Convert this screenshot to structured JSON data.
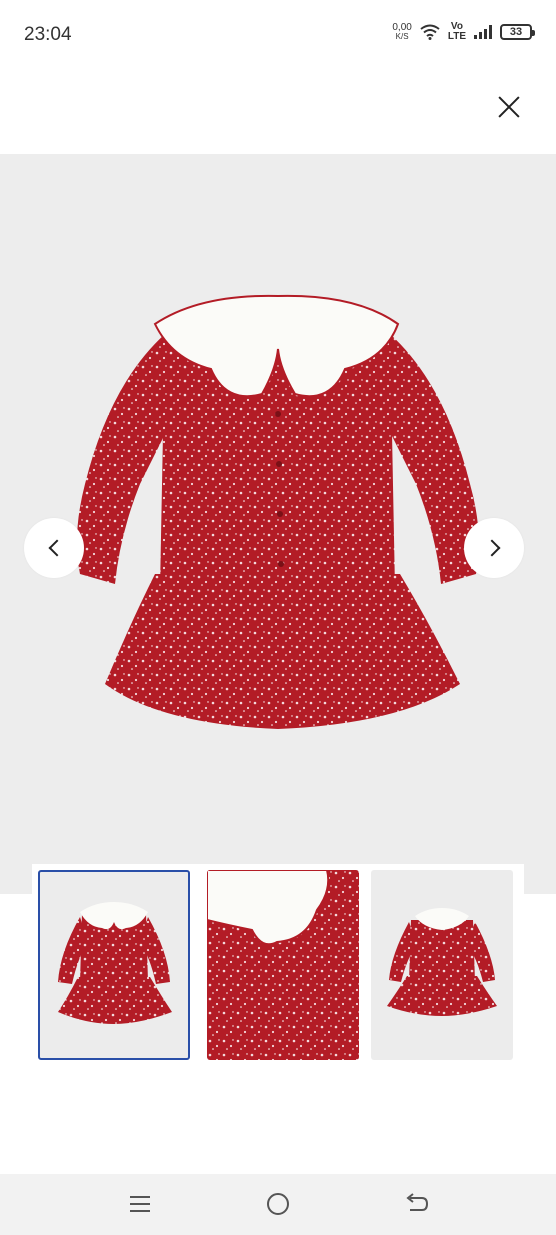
{
  "status_bar": {
    "time": "23:04",
    "net_speed_value": "0,00",
    "net_speed_unit": "K/S",
    "volte_top": "Vo",
    "volte_bottom": "LTE",
    "battery": "33"
  },
  "gallery": {
    "selected_index": 0,
    "thumbnail_count": 3
  },
  "colors": {
    "dress_red": "#b31c26",
    "collar_white": "#fbfbf8",
    "background": "#ededed",
    "selected_border": "#2a4fa8"
  }
}
